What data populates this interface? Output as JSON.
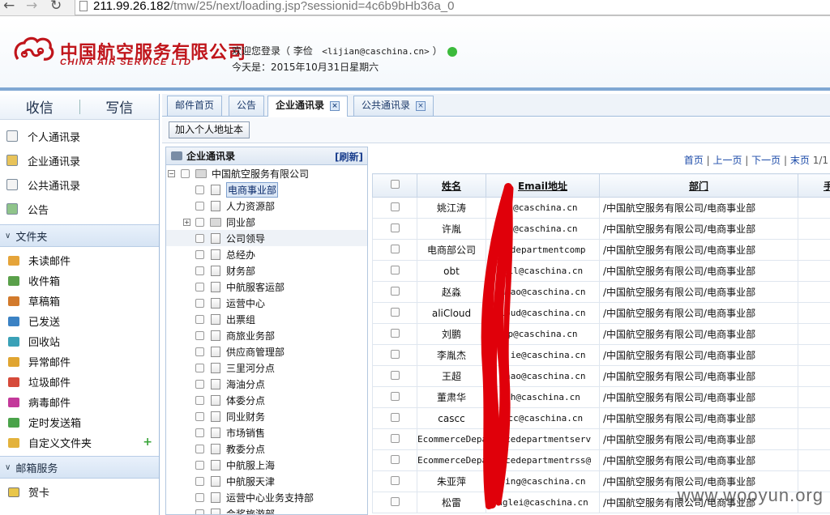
{
  "browser": {
    "url_host": "211.99.26.182",
    "url_path": "/tmw/25/next/loading.jsp?sessionid=4c6b9bHb36a_0"
  },
  "header": {
    "logo_cn": "中国航空服务有限公司",
    "logo_en": "CHINA AIR SERVICE LTD",
    "welcome_prefix": "欢迎您登录（ 李俭",
    "welcome_email": "<lijian@caschina.cn>",
    "welcome_suffix": "）",
    "today": "今天是：2015年10月31日星期六"
  },
  "sidebar": {
    "compose": "收信",
    "write": "写信",
    "items": [
      {
        "label": "个人通讯录",
        "icon": "personal-contacts-icon"
      },
      {
        "label": "企业通讯录",
        "icon": "enterprise-contacts-icon"
      },
      {
        "label": "公共通讯录",
        "icon": "public-contacts-icon"
      },
      {
        "label": "公告",
        "icon": "announcement-icon"
      }
    ],
    "folders_title": "文件夹",
    "folders": [
      {
        "label": "未读邮件",
        "color": "#e5a43a"
      },
      {
        "label": "收件箱",
        "color": "#5aa04a"
      },
      {
        "label": "草稿箱",
        "color": "#d27a2c"
      },
      {
        "label": "已发送",
        "color": "#3b82c4"
      },
      {
        "label": "回收站",
        "color": "#3aa1b7"
      },
      {
        "label": "异常邮件",
        "color": "#e0a531"
      },
      {
        "label": "垃圾邮件",
        "color": "#d64a3a"
      },
      {
        "label": "病毒邮件",
        "color": "#c3399a"
      },
      {
        "label": "定时发送箱",
        "color": "#4aa34a"
      },
      {
        "label": "自定义文件夹",
        "color": "#e3b23c"
      }
    ],
    "services_title": "邮箱服务",
    "services": [
      {
        "label": "贺卡"
      }
    ]
  },
  "tabs": [
    {
      "label": "邮件首页",
      "closable": false,
      "active": false
    },
    {
      "label": "公告",
      "closable": false,
      "active": false
    },
    {
      "label": "企业通讯录",
      "closable": true,
      "active": true
    },
    {
      "label": "公共通讯录",
      "closable": true,
      "active": false
    }
  ],
  "toolbar": {
    "add_button": "加入个人地址本"
  },
  "tree": {
    "title": "企业通讯录",
    "refresh": "[刷新]",
    "root": "中国航空服务有限公司",
    "nodes": [
      {
        "label": "电商事业部",
        "selected": true,
        "folder": false
      },
      {
        "label": "人力资源部",
        "selected": false,
        "folder": false
      },
      {
        "label": "同业部",
        "selected": false,
        "folder": true
      },
      {
        "label": "公司领导",
        "selected": false,
        "folder": false
      },
      {
        "label": "总经办",
        "selected": false,
        "folder": false
      },
      {
        "label": "财务部",
        "selected": false,
        "folder": false
      },
      {
        "label": "中航服客运部",
        "selected": false,
        "folder": false
      },
      {
        "label": "运营中心",
        "selected": false,
        "folder": false
      },
      {
        "label": "出票组",
        "selected": false,
        "folder": false
      },
      {
        "label": "商旅业务部",
        "selected": false,
        "folder": false
      },
      {
        "label": "供应商管理部",
        "selected": false,
        "folder": false
      },
      {
        "label": "三里河分点",
        "selected": false,
        "folder": false
      },
      {
        "label": "海油分点",
        "selected": false,
        "folder": false
      },
      {
        "label": "体委分点",
        "selected": false,
        "folder": false
      },
      {
        "label": "同业财务",
        "selected": false,
        "folder": false
      },
      {
        "label": "市场销售",
        "selected": false,
        "folder": false
      },
      {
        "label": "教委分点",
        "selected": false,
        "folder": false
      },
      {
        "label": "中航服上海",
        "selected": false,
        "folder": false
      },
      {
        "label": "中航服天津",
        "selected": false,
        "folder": false
      },
      {
        "label": "运营中心业务支持部",
        "selected": false,
        "folder": false
      },
      {
        "label": "会奖旅游部",
        "selected": false,
        "folder": false
      }
    ]
  },
  "pager": {
    "first": "首页",
    "prev": "上一页",
    "next": "下一页",
    "last": "末页",
    "page": "1/1"
  },
  "table": {
    "columns": [
      "姓名",
      "Email地址",
      "部门",
      "手"
    ],
    "rows": [
      {
        "name": "姚江涛",
        "email": "t@caschina.cn",
        "dept": "/中国航空服务有限公司/电商事业部"
      },
      {
        "name": "许胤",
        "email": "n@caschina.cn",
        "dept": "/中国航空服务有限公司/电商事业部"
      },
      {
        "name": "电商部公司",
        "email": "cedepartmentcomp",
        "dept": "/中国航空服务有限公司/电商事业部"
      },
      {
        "name": "obt",
        "email": "ail@caschina.cn",
        "dept": "/中国航空服务有限公司/电商事业部"
      },
      {
        "name": "赵淼",
        "email": "miao@caschina.cn",
        "dept": "/中国航空服务有限公司/电商事业部"
      },
      {
        "name": "aliCloud",
        "email": "loud@caschina.cn",
        "dept": "/中国航空服务有限公司/电商事业部"
      },
      {
        "name": "刘鹏",
        "email": "p@caschina.cn",
        "dept": "/中国航空服务有限公司/电商事业部"
      },
      {
        "name": "李胤杰",
        "email": "njie@caschina.cn",
        "dept": "/中国航空服务有限公司/电商事业部"
      },
      {
        "name": "王超",
        "email": "chao@caschina.cn",
        "dept": "/中国航空服务有限公司/电商事业部"
      },
      {
        "name": "董肃华",
        "email": "sh@caschina.cn",
        "dept": "/中国航空服务有限公司/电商事业部"
      },
      {
        "name": "cascc",
        "email": "scc@caschina.cn",
        "dept": "/中国航空服务有限公司/电商事业部"
      },
      {
        "name": "EcommerceDepared",
        "email": "ercedepartmentserv",
        "dept": "/中国航空服务有限公司/电商事业部"
      },
      {
        "name": "EcommerceDepared",
        "email": "ercedepartmentrss@",
        "dept": "/中国航空服务有限公司/电商事业部"
      },
      {
        "name": "朱亚萍",
        "email": "ping@caschina.cn",
        "dept": "/中国航空服务有限公司/电商事业部"
      },
      {
        "name": "松雷",
        "email": "nglei@caschina.cn",
        "dept": "/中国航空服务有限公司/电商事业部"
      }
    ]
  },
  "watermark": "www.wooyun.org",
  "colors": {
    "brand_red": "#c0151b",
    "header_border": "#7fa7d3",
    "link_blue": "#1b4aa8",
    "scribble_red": "#e0000a"
  }
}
